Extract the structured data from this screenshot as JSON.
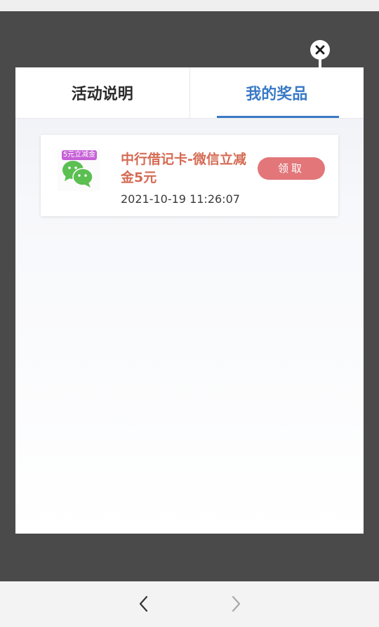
{
  "tabs": [
    {
      "label": "活动说明",
      "active": false
    },
    {
      "label": "我的奖品",
      "active": true
    }
  ],
  "prize": {
    "badge": "5元立减金",
    "title": "中行借记卡-微信立减金5元",
    "time": "2021-10-19 11:26:07",
    "claim_label": "领取"
  },
  "icons": {
    "close": "close-icon",
    "back": "back-arrow-icon",
    "forward": "forward-arrow-icon",
    "prize": "wechat-icon"
  },
  "colors": {
    "active_tab": "#3a79c6",
    "prize_title": "#d56b54",
    "claim_button": "#e27679",
    "overlay": "#4a4a4a"
  }
}
